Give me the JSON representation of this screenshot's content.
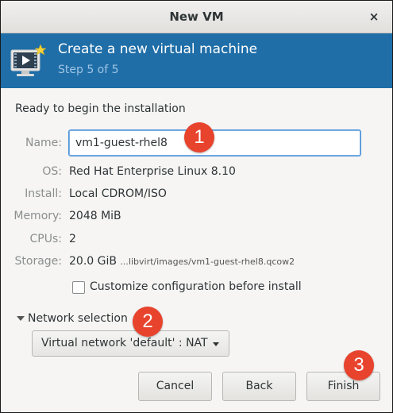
{
  "window": {
    "title": "New VM",
    "close_glyph": "×"
  },
  "header": {
    "title": "Create a new virtual machine",
    "step": "Step 5 of 5",
    "icon": "vm-monitor-icon",
    "colors": {
      "banner": "#1f6ea8",
      "step_text": "#9fc4e4"
    }
  },
  "summary": {
    "heading": "Ready to begin the installation",
    "name": {
      "label": "Name:",
      "value": "vm1-guest-rhel8"
    },
    "os": {
      "label": "OS:",
      "value": "Red Hat Enterprise Linux 8.10"
    },
    "install": {
      "label": "Install:",
      "value": "Local CDROM/ISO"
    },
    "memory": {
      "label": "Memory:",
      "value": "2048 MiB"
    },
    "cpus": {
      "label": "CPUs:",
      "value": "2"
    },
    "storage": {
      "label": "Storage:",
      "size": "20.0 GiB",
      "path": "...libvirt/images/vm1-guest-rhel8.qcow2"
    }
  },
  "customize": {
    "label": "Customize configuration before install",
    "checked": false
  },
  "network": {
    "expander_label": "Network selection",
    "selected": "Virtual network 'default' : NAT"
  },
  "buttons": {
    "cancel": "Cancel",
    "back": "Back",
    "finish": "Finish"
  },
  "annotations": [
    {
      "number": "1"
    },
    {
      "number": "2"
    },
    {
      "number": "3"
    }
  ],
  "colors": {
    "annotation": "#e8432d",
    "focus_border": "#4a90d9"
  }
}
